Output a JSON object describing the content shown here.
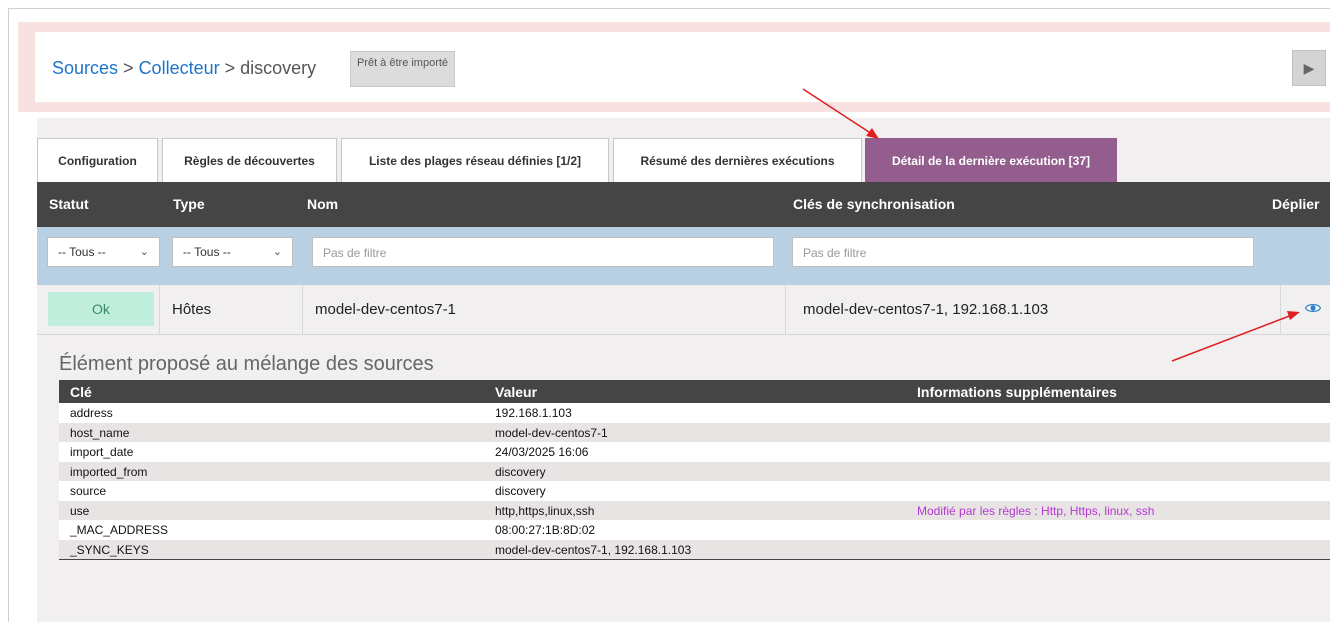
{
  "breadcrumb": {
    "sources": "Sources",
    "sep1": " > ",
    "collector": "Collecteur",
    "sep2": " > ",
    "current": "discovery"
  },
  "status_badge": "Prêt à être importé",
  "play_icon": "play-icon",
  "tabs": [
    {
      "label": "Configuration",
      "active": false
    },
    {
      "label": "Règles de découvertes",
      "active": false
    },
    {
      "label": "Liste des plages réseau définies [1/2]",
      "active": false
    },
    {
      "label": "Résumé des dernières exécutions",
      "active": false
    },
    {
      "label": "Détail de la dernière exécution [37]",
      "active": true
    }
  ],
  "columns": {
    "status": "Statut",
    "type": "Type",
    "name": "Nom",
    "sync_keys": "Clés de synchronisation",
    "expand": "Déplier"
  },
  "filters": {
    "status_selected": "-- Tous --",
    "type_selected": "-- Tous --",
    "name_placeholder": "Pas de filtre",
    "keys_placeholder": "Pas de filtre"
  },
  "row": {
    "status": "Ok",
    "type": "Hôtes",
    "name": "model-dev-centos7-1",
    "sync_keys": "model-dev-centos7-1, 192.168.1.103",
    "expand_icon": "eye-icon"
  },
  "proposal": {
    "title": "Élément proposé au mélange des sources",
    "headers": {
      "key": "Clé",
      "value": "Valeur",
      "info": "Informations supplémentaires"
    },
    "rows": [
      {
        "key": "address",
        "value": "192.168.1.103",
        "info": ""
      },
      {
        "key": "host_name",
        "value": "model-dev-centos7-1",
        "info": ""
      },
      {
        "key": "import_date",
        "value": "24/03/2025 16:06",
        "info": ""
      },
      {
        "key": "imported_from",
        "value": "discovery",
        "info": ""
      },
      {
        "key": "source",
        "value": "discovery",
        "info": ""
      },
      {
        "key": "use",
        "value": "http,https,linux,ssh",
        "info": "Modifié par les règles : Http, Https, linux, ssh"
      },
      {
        "key": "_MAC_ADDRESS",
        "value": "08:00:27:1B:8D:02",
        "info": ""
      },
      {
        "key": "_SYNC_KEYS",
        "value": "model-dev-centos7-1, 192.168.1.103",
        "info": ""
      }
    ]
  },
  "colors": {
    "accent_tab": "#935e8d",
    "link": "#1f74c9",
    "ok_badge": "#bfeedd",
    "info_text": "#b23ad0",
    "annotation_arrow": "#e02020"
  }
}
